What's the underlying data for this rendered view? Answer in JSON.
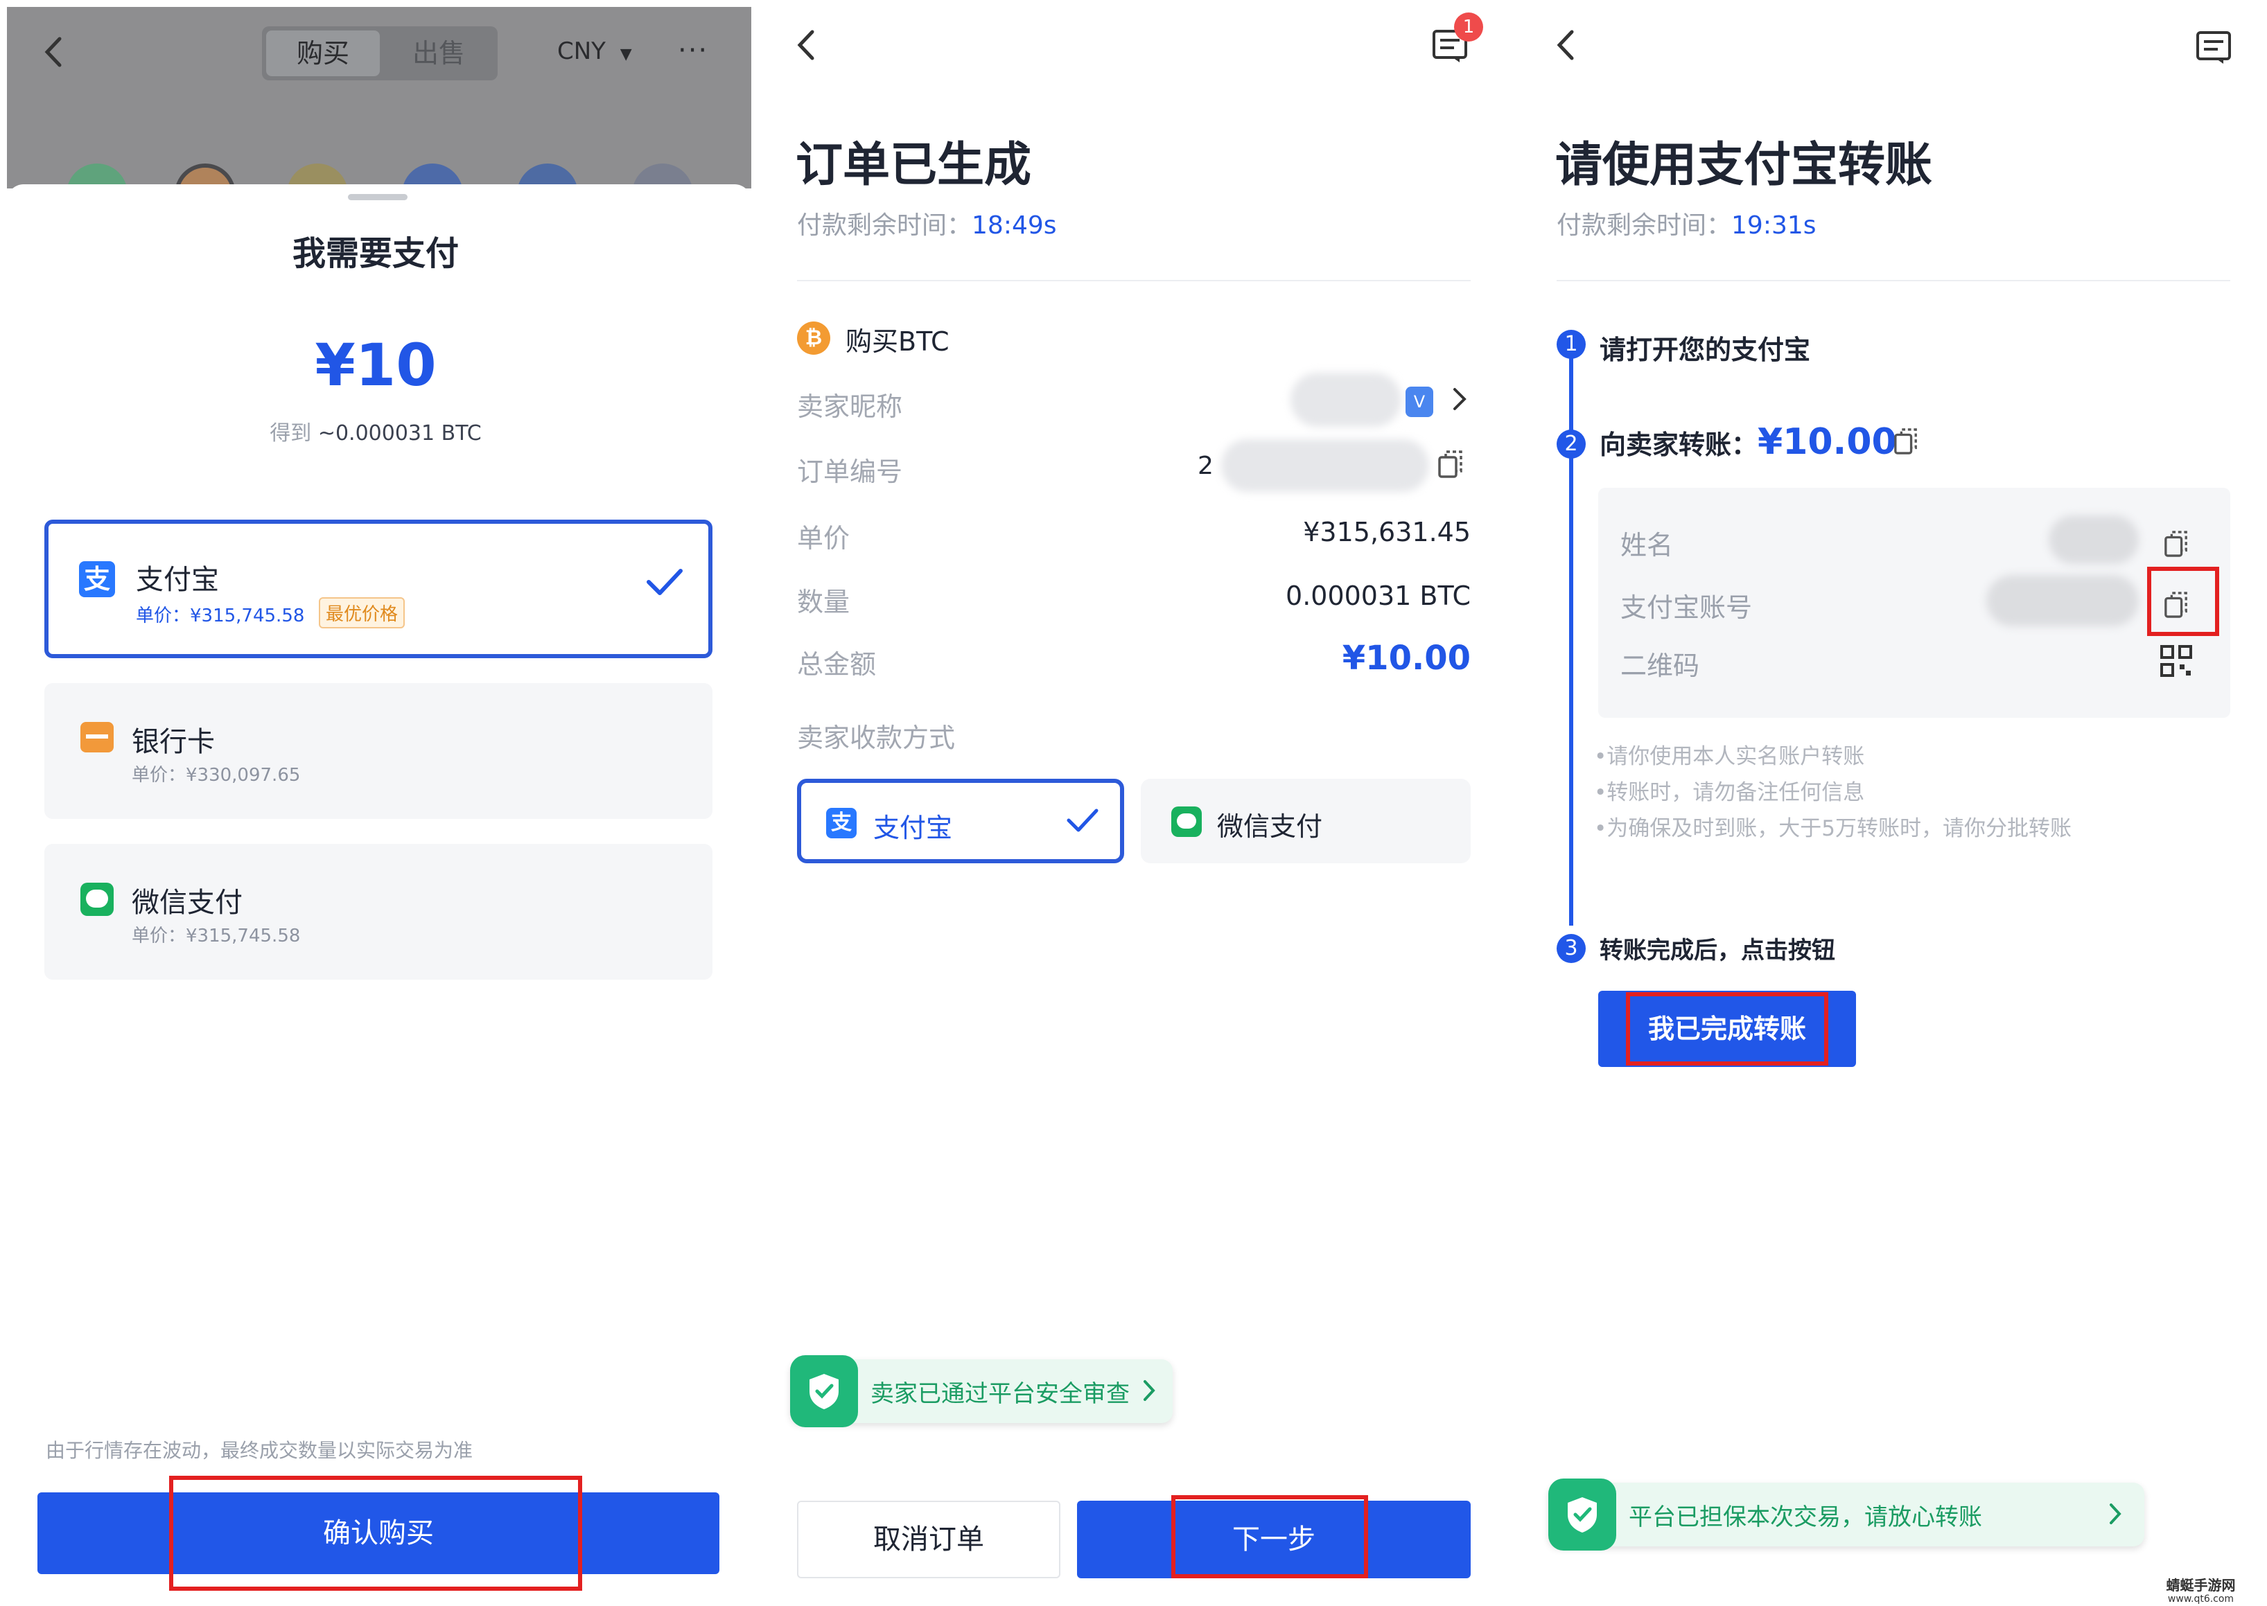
{
  "colors": {
    "accent": "#2157E8",
    "price_blue": "#2156E6",
    "success_green": "#20B87A",
    "highlight_red": "#E32020",
    "badge_orange": "#E08A1E"
  },
  "screen1": {
    "header": {
      "back_icon": "chevron-left-icon",
      "tab_buy": "购买",
      "tab_sell": "出售",
      "currency": "CNY",
      "more_icon": "more-horizontal-icon"
    },
    "sheet_title": "我需要支付",
    "amount": "¥10",
    "receive_prefix": "得到 ",
    "receive_value": "~0.000031 BTC",
    "methods": [
      {
        "icon": "alipay-icon",
        "name": "支付宝",
        "price": "单价：¥315,745.58",
        "badge": "最优价格",
        "selected": true
      },
      {
        "icon": "bank-card-icon",
        "name": "银行卡",
        "price": "单价：¥330,097.65",
        "selected": false
      },
      {
        "icon": "wechat-pay-icon",
        "name": "微信支付",
        "price": "单价：¥315,745.58",
        "selected": false
      }
    ],
    "disclaimer": "由于行情存在波动，最终成交数量以实际交易为准",
    "confirm_label": "确认购买"
  },
  "screen2": {
    "chat_badge": "1",
    "title": "订单已生成",
    "countdown_label": "付款剩余时间：",
    "countdown_value": "18:49s",
    "buy_label": "购买BTC",
    "rows": {
      "seller_label": "卖家昵称",
      "order_label": "订单编号",
      "order_prefix": "2",
      "unit_price_label": "单价",
      "unit_price_value": "¥315,631.45",
      "quantity_label": "数量",
      "quantity_value": "0.000031 BTC",
      "total_label": "总金额",
      "total_value": "¥10.00",
      "method_label": "卖家收款方式"
    },
    "method_alipay": "支付宝",
    "method_wechat": "微信支付",
    "safety_text": "卖家已通过平台安全审查",
    "cancel_label": "取消订单",
    "next_label": "下一步"
  },
  "screen3": {
    "title": "请使用支付宝转账",
    "countdown_label": "付款剩余时间：",
    "countdown_value": "19:31s",
    "step1": "请打开您的支付宝",
    "step2_label": "向卖家转账：",
    "step2_amount": "¥10.00",
    "info": {
      "name_label": "姓名",
      "account_label": "支付宝账号",
      "qr_label": "二维码"
    },
    "notes": [
      "•请你使用本人实名账户转账",
      "•转账时，请勿备注任何信息",
      "•为确保及时到账，大于5万转账时，请你分批转账"
    ],
    "step3": "转账完成后，点击按钮",
    "done_label": "我已完成转账",
    "safety_text": "平台已担保本次交易，请放心转账"
  },
  "watermark": {
    "line1": "蜻蜓手游网",
    "line2": "www.qt6.com"
  }
}
